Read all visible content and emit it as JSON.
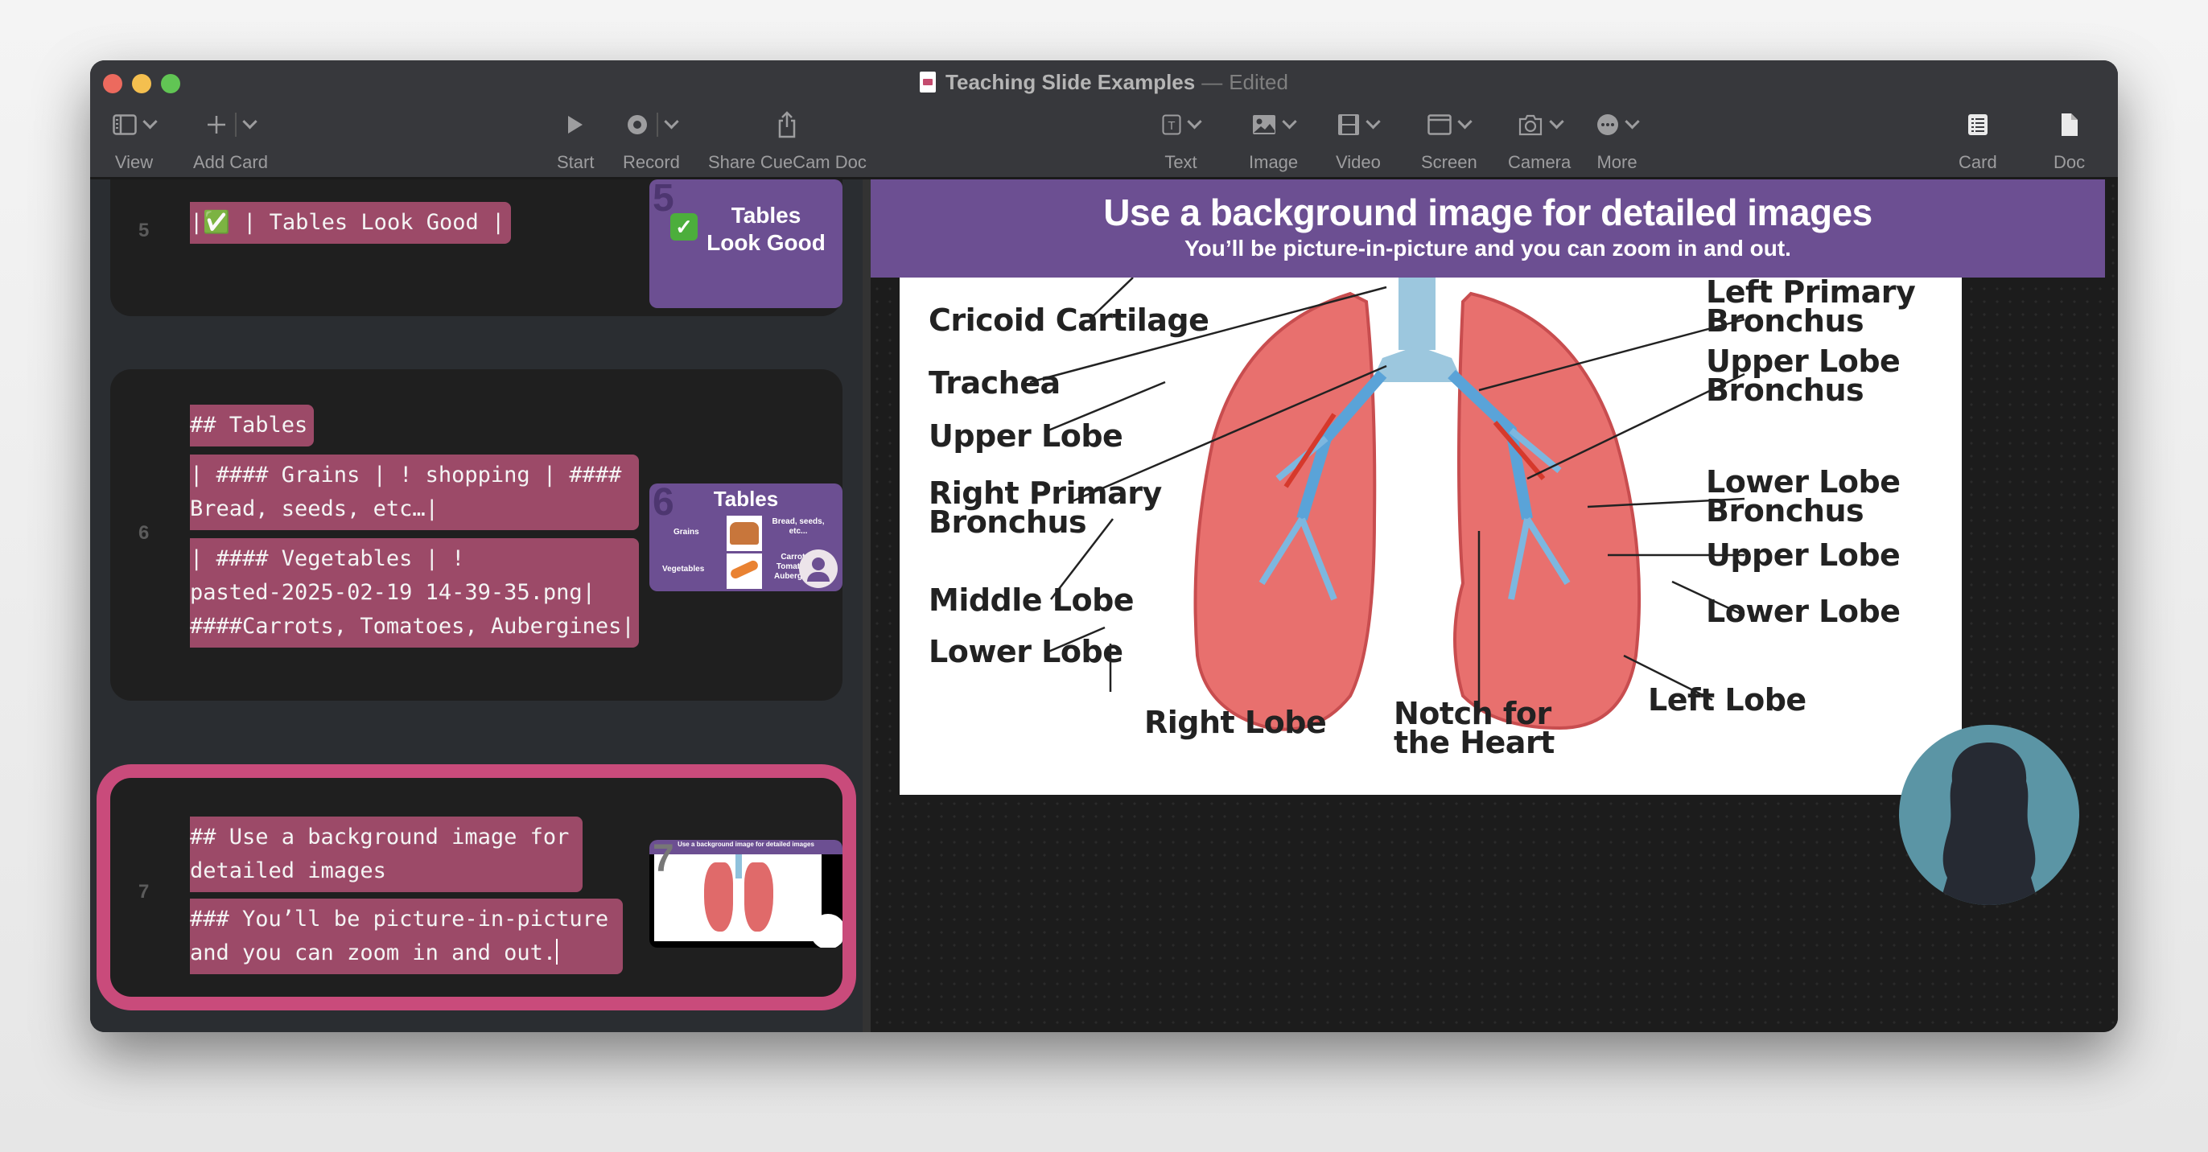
{
  "window": {
    "title": "Teaching Slide Examples",
    "separator": "—",
    "status": "Edited"
  },
  "toolbar": {
    "left": [
      {
        "label": "View",
        "icon": "sidebar-icon",
        "has_menu": true
      },
      {
        "label": "Add Card",
        "icon": "plus-icon",
        "has_menu": true
      }
    ],
    "center": [
      {
        "label": "Start",
        "icon": "play-icon"
      },
      {
        "label": "Record",
        "icon": "record-icon",
        "has_menu": true
      },
      {
        "label": "Share CueCam Doc",
        "icon": "share-icon"
      }
    ],
    "insert": [
      {
        "label": "Text",
        "icon": "text-box-icon",
        "has_menu": true
      },
      {
        "label": "Image",
        "icon": "image-icon",
        "has_menu": true
      },
      {
        "label": "Video",
        "icon": "film-icon",
        "has_menu": true
      },
      {
        "label": "Screen",
        "icon": "window-icon",
        "has_menu": true
      },
      {
        "label": "Camera",
        "icon": "camera-icon",
        "has_menu": true
      },
      {
        "label": "More",
        "icon": "ellipsis-icon",
        "has_menu": true
      }
    ],
    "right": [
      {
        "label": "Card",
        "icon": "card-list-icon"
      },
      {
        "label": "Doc",
        "icon": "document-icon"
      }
    ]
  },
  "cards": [
    {
      "number": "5",
      "lines": [
        "|✅ | Tables Look Good |"
      ],
      "thumbnail": {
        "number": "5",
        "title_line1": "Tables",
        "title_line2": "Look Good"
      }
    },
    {
      "number": "6",
      "lines": [
        "## Tables",
        "| #### Grains | ! shopping | ####\nBread, seeds, etc…|",
        "| #### Vegetables | !\npasted-2025-02-19 14-39-35.png|\n####Carrots, Tomatoes, Aubergines|"
      ],
      "thumbnail": {
        "number": "6",
        "title": "Tables",
        "rows": [
          {
            "label": "Grains",
            "image": "bread",
            "text": "Bread, seeds, etc..."
          },
          {
            "label": "Vegetables",
            "image": "carrots",
            "text": "Carrots, Tomatoes, Aubergines"
          }
        ]
      }
    },
    {
      "number": "7",
      "selected": true,
      "lines": [
        "## Use a background image for\ndetailed images",
        "### You’ll be picture-in-picture\nand you can zoom in and out."
      ],
      "thumbnail": {
        "number": "7",
        "title": "Use a background image for detailed images",
        "subtitle": "You'll be picture-in-picture and you can zoom in and out."
      }
    }
  ],
  "slide": {
    "title": "Use a background image for detailed images",
    "subtitle": "You’ll be picture-in-picture and you can zoom in and out.",
    "accent_color": "#6c4f92",
    "diagram_labels": {
      "cricoid": "Cricoid Cartilage",
      "trachea": "Trachea",
      "upper_lobe_r": "Upper Lobe",
      "right_primary": "Right Primary\nBronchus",
      "middle_lobe": "Middle Lobe",
      "lower_lobe_r": "Lower Lobe",
      "right_lobe": "Right Lobe",
      "notch": "Notch for\nthe Heart",
      "left_primary": "Left Primary\nBronchus",
      "upper_lobe_bronchus": "Upper Lobe\nBronchus",
      "lower_lobe_bronchus": "Lower Lobe\nBronchus",
      "upper_lobe_l": "Upper Lobe",
      "lower_lobe_l": "Lower Lobe",
      "left_lobe": "Left Lobe"
    }
  },
  "colors": {
    "selection": "#c94b7b",
    "markdown_highlight": "#9c4a68",
    "slide_purple": "#6c4f92",
    "avatar_bg": "#5b95a5"
  }
}
